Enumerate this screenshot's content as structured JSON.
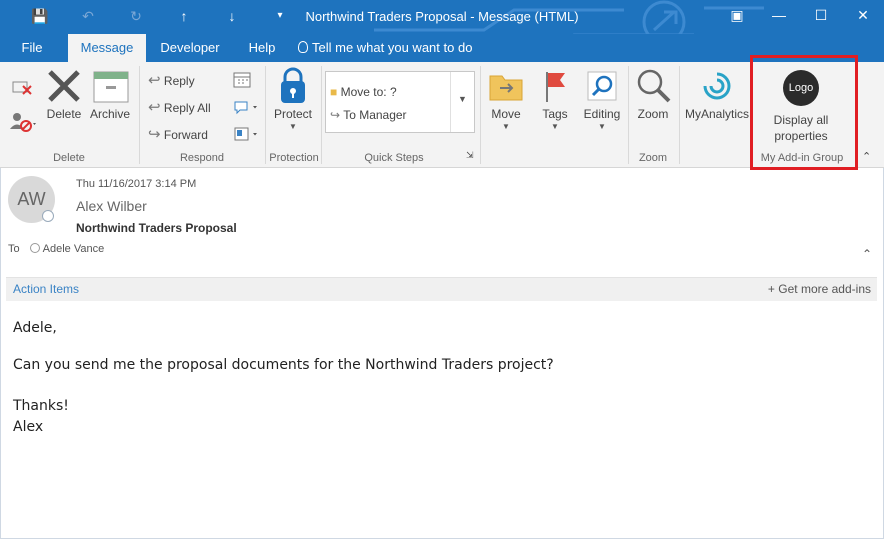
{
  "window": {
    "title": "Northwind Traders Proposal  -  Message (HTML)",
    "accent_color": "#1e73be",
    "qat_icons": [
      "save-icon",
      "undo-icon",
      "redo-icon",
      "arrow-up-icon",
      "arrow-down-icon",
      "customize-qat-icon"
    ],
    "controls": [
      "ribbon-display-icon",
      "minimize-icon",
      "maximize-icon",
      "close-icon"
    ]
  },
  "tabs": {
    "file": "File",
    "message": "Message",
    "developer": "Developer",
    "help": "Help",
    "tell_me": "Tell me what you want to do"
  },
  "ribbon": {
    "delete_group": {
      "label": "Delete",
      "delete": "Delete",
      "archive": "Archive"
    },
    "respond_group": {
      "label": "Respond",
      "reply": "Reply",
      "reply_all": "Reply All",
      "forward": "Forward"
    },
    "protection_group": {
      "label": "Protection",
      "protect": "Protect"
    },
    "quick_steps_group": {
      "label": "Quick Steps",
      "move_to": "Move to: ?",
      "to_manager": "To Manager"
    },
    "move": "Move",
    "tags": "Tags",
    "editing": "Editing",
    "zoom_group": {
      "label": "Zoom",
      "zoom": "Zoom"
    },
    "myanalytics": "MyAnalytics",
    "addin_group": {
      "label": "My Add-in Group",
      "logo": "Logo",
      "button": "Display all properties",
      "highlight_color": "#e01e23"
    }
  },
  "message": {
    "initials": "AW",
    "date": "Thu 11/16/2017 3:14 PM",
    "sender": "Alex Wilber",
    "subject": "Northwind Traders Proposal",
    "to_label": "To",
    "recipient": "Adele Vance"
  },
  "actionbar": {
    "action_items": "Action Items",
    "get_more": "Get more add-ins"
  },
  "body": {
    "greeting": "Adele,",
    "line1": "Can you send me the proposal documents for the Northwind Traders project?",
    "thanks": "Thanks!",
    "signature": "Alex"
  }
}
